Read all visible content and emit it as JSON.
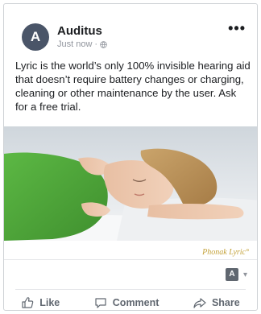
{
  "post": {
    "author": "Auditus",
    "avatar_letter": "A",
    "timestamp": "Just now",
    "meta_separator": "·",
    "audience_icon": "globe-icon",
    "more_icon": "more-options-icon",
    "more_label": "•••",
    "text": "Lyric is the world’s only 100% invisible hearing aid that doesn’t require battery changes or charging, cleaning or other maintenance by the user. Ask for a free trial.",
    "image": {
      "brand_caption": "Phonak Lyric°"
    }
  },
  "reactions": {
    "viewer_avatar_letter": "A",
    "caret": "▾"
  },
  "actions": {
    "like_label": "Like",
    "comment_label": "Comment",
    "share_label": "Share"
  },
  "colors": {
    "avatar_bg": "#4a5568",
    "text_primary": "#1c1e21",
    "text_secondary": "#90949c",
    "action_text": "#606770",
    "brand_gold": "#c4a23a",
    "shirt_green": "#4fa83a"
  }
}
